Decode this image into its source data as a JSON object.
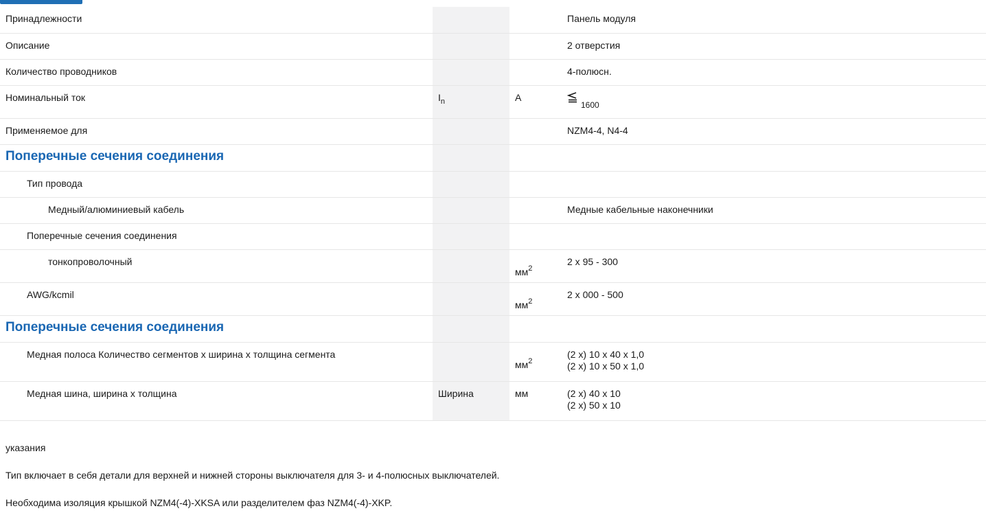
{
  "rows": {
    "accessories": {
      "label": "Принадлежности",
      "value": "Панель модуля"
    },
    "description": {
      "label": "Описание",
      "value": "2 отверстия"
    },
    "poles": {
      "label": "Количество проводников",
      "value": "4-полюсн."
    },
    "current": {
      "label": "Номинальный ток",
      "symbol_main": "I",
      "symbol_sub": "n",
      "unit": "A",
      "value_icon": "less-equal-icon",
      "value": "1600"
    },
    "applicable": {
      "label": "Применяемое для",
      "value": "NZM4-4, N4-4"
    },
    "section1": {
      "title": "Поперечные сечения соединения"
    },
    "wire_type": {
      "label": "Тип провода"
    },
    "cable": {
      "label": "Медный/алюминиевый кабель",
      "value": "Медные кабельные наконечники"
    },
    "cross_sections": {
      "label": "Поперечные сечения соединения"
    },
    "fine_wire": {
      "label": "тонкопроволочный",
      "unit": "мм",
      "unit_sup": "2",
      "value": "2 x 95 - 300"
    },
    "awg": {
      "label": "AWG/kcmil",
      "unit": "мм",
      "unit_sup": "2",
      "value": "2 x 000 - 500"
    },
    "section2": {
      "title": "Поперечные сечения соединения"
    },
    "copper_strip": {
      "label": "Медная полоса Количество сегментов x ширина x толщина сегмента",
      "unit": "мм",
      "unit_sup": "2",
      "value_1": "(2 x) 10 x 40 x 1,0",
      "value_2": "(2 x) 10 x 50 x 1,0"
    },
    "copper_bar": {
      "label": "Медная шина, ширина x толщина",
      "symbol": "Ширина",
      "unit": "мм",
      "value_1": "(2 x) 40 x 10",
      "value_2": "(2 x) 50 x 10"
    }
  },
  "notes": {
    "heading": "указания",
    "line1": "Тип включает в себя детали для верхней и нижней стороны выключателя для 3- и 4-полюсных выключателей.",
    "line2": "Необходима изоляция крышкой NZM4(-4)-XKSA или разделителем фаз NZM4(-4)-XKP."
  },
  "colors": {
    "section_title": "#1a67b3",
    "symbol_column_bg": "#f2f2f3",
    "divider": "#e6e6e6"
  }
}
